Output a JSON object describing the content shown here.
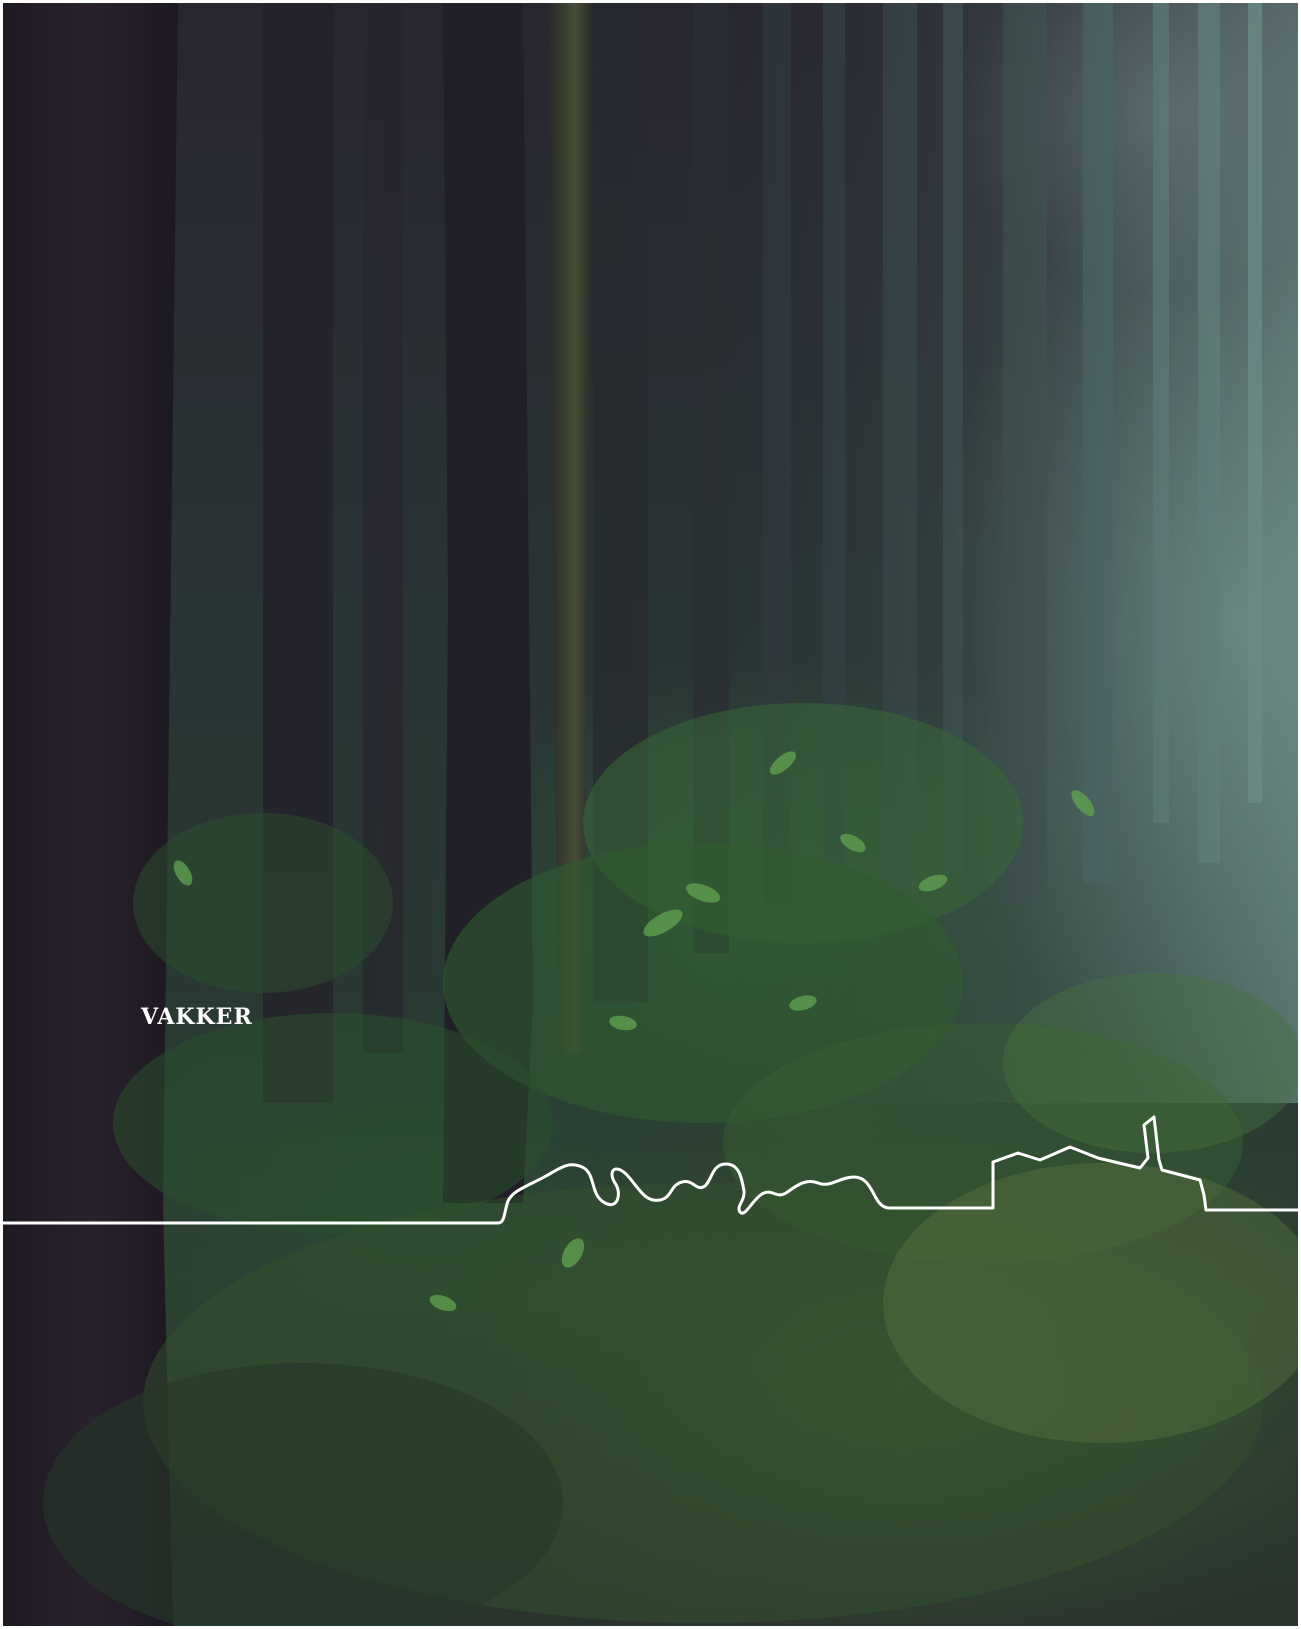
{
  "photo": {
    "subject": "forest-photo"
  },
  "caption": {
    "text": "VAKKER"
  },
  "colors": {
    "frame": "#ffffff",
    "line": "#ffffff",
    "caption": "#ffffff"
  }
}
